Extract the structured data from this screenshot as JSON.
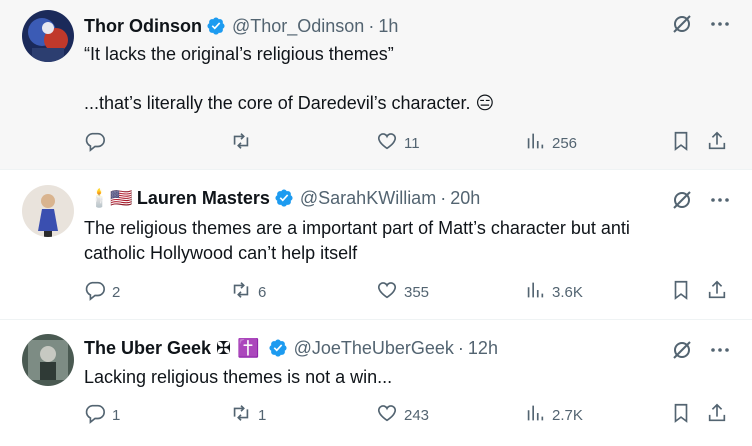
{
  "tweets": [
    {
      "display_name": "Thor Odinson",
      "handle": "@Thor_Odinson",
      "separator": "·",
      "time": "1h",
      "text_line1": "“It lacks the original’s religious themes”",
      "text_line2": "...that’s literally the core of Daredevil’s character. 😑",
      "replies": "",
      "retweets": "",
      "likes": "11",
      "views": "256"
    },
    {
      "name_prefix": "🕯️🇺🇸",
      "display_name": "Lauren Masters",
      "handle": "@SarahKWilliam",
      "separator": "·",
      "time": "20h",
      "text_line1": "The religious themes are a important part of Matt’s character but anti",
      "text_line2": "catholic Hollywood can’t help itself",
      "replies": "2",
      "retweets": "6",
      "likes": "355",
      "views": "3.6K"
    },
    {
      "display_name": "The Uber Geek ✠",
      "name_suffix": "✝️",
      "handle": "@JoeTheUberGeek",
      "separator": "·",
      "time": "12h",
      "text_line1": "Lacking religious themes is not a win...",
      "replies": "1",
      "retweets": "1",
      "likes": "243",
      "views": "2.7K"
    }
  ],
  "colors": {
    "verified": "#1d9bf0",
    "icon_gray": "#536471",
    "text": "#0f1419",
    "highlight_bg": "#f7f7f7"
  },
  "icons": [
    "verified-badge-icon",
    "grok-icon",
    "more-icon",
    "reply-icon",
    "retweet-icon",
    "like-icon",
    "views-icon",
    "bookmark-icon",
    "share-icon"
  ]
}
